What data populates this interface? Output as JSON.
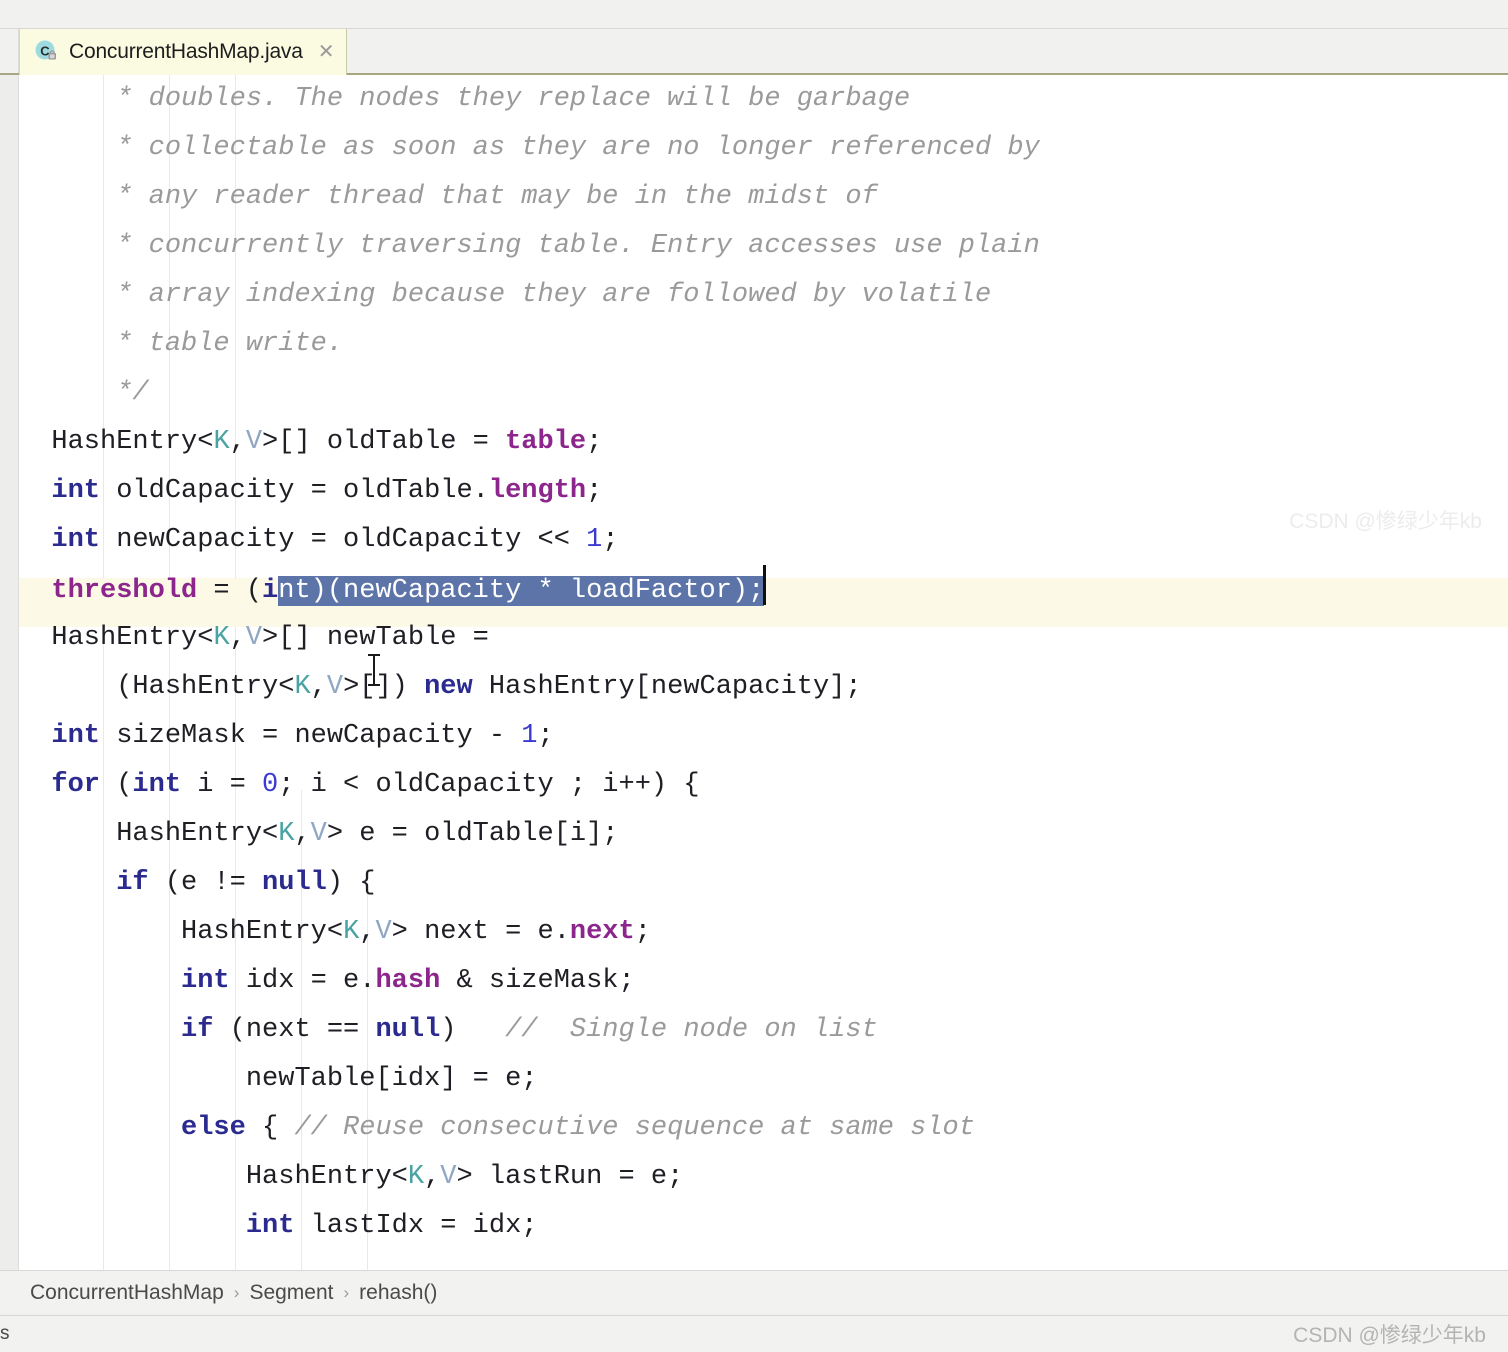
{
  "window": {
    "app": "IntelliJ IDEA Editor"
  },
  "tabs": [
    {
      "label": "ConcurrentHashMap.java",
      "icon": "java-class-locked-icon",
      "close_icon": "close-icon",
      "active": true
    }
  ],
  "breadcrumb": {
    "separator": "›",
    "items": [
      "ConcurrentHashMap",
      "Segment",
      "rehash()"
    ]
  },
  "statusbar": {
    "watermark": "CSDN @惨绿少年kb",
    "left_clipped": "s"
  },
  "editor": {
    "highlighted_line_index": 10,
    "selection": {
      "line_index": 10,
      "text": "nt)(newCapacity * loadFactor);",
      "caret_after": true
    },
    "colors": {
      "background": "#ffffff",
      "current_line": "#fcfae6",
      "selection_bg": "#5d74a8",
      "selection_fg": "#ffffff",
      "comment": "#9a9a9a",
      "keyword": "#2b2b8f",
      "field": "#8c258c",
      "generic_k": "#49a3a3",
      "generic_v": "#8fa6c4",
      "number": "#3a3ad0",
      "plain": "#1e1e24",
      "tab_active_bg": "#fbfbe2",
      "tab_underline": "#a6a680",
      "gutter": "#ededeb"
    },
    "lines": [
      {
        "indent": 1,
        "tokens": [
          {
            "t": "cm",
            "v": "* doubles. The nodes they replace will be garbage"
          }
        ]
      },
      {
        "indent": 1,
        "tokens": [
          {
            "t": "cm",
            "v": "* collectable as soon as they are no longer referenced by"
          }
        ]
      },
      {
        "indent": 1,
        "tokens": [
          {
            "t": "cm",
            "v": "* any reader thread that may be in the midst of"
          }
        ]
      },
      {
        "indent": 1,
        "tokens": [
          {
            "t": "cm",
            "v": "* concurrently traversing table. Entry accesses use plain"
          }
        ]
      },
      {
        "indent": 1,
        "tokens": [
          {
            "t": "cm",
            "v": "* array indexing because they are followed by volatile"
          }
        ]
      },
      {
        "indent": 1,
        "tokens": [
          {
            "t": "cm",
            "v": "* table write."
          }
        ]
      },
      {
        "indent": 1,
        "tokens": [
          {
            "t": "cm",
            "v": "*/"
          }
        ]
      },
      {
        "indent": 0,
        "tokens": [
          {
            "t": "pl",
            "v": "HashEntry"
          },
          {
            "t": "pl",
            "v": "<"
          },
          {
            "t": "gk",
            "v": "K"
          },
          {
            "t": "pl",
            "v": ","
          },
          {
            "t": "gv",
            "v": "V"
          },
          {
            "t": "pl",
            "v": ">[] oldTable = "
          },
          {
            "t": "fld",
            "v": "table"
          },
          {
            "t": "pl",
            "v": ";"
          }
        ]
      },
      {
        "indent": 0,
        "tokens": [
          {
            "t": "kw",
            "v": "int"
          },
          {
            "t": "pl",
            "v": " oldCapacity = oldTable."
          },
          {
            "t": "fld",
            "v": "length"
          },
          {
            "t": "pl",
            "v": ";"
          }
        ]
      },
      {
        "indent": 0,
        "tokens": [
          {
            "t": "kw",
            "v": "int"
          },
          {
            "t": "pl",
            "v": " newCapacity = oldCapacity << "
          },
          {
            "t": "num",
            "v": "1"
          },
          {
            "t": "pl",
            "v": ";"
          }
        ]
      },
      {
        "indent": 0,
        "highlighted": true,
        "tokens": [
          {
            "t": "fld",
            "v": "threshold"
          },
          {
            "t": "pl",
            "v": " = ("
          },
          {
            "t": "kw",
            "v": "i"
          },
          {
            "t": "sel",
            "v": "nt)(newCapacity * loadFactor);"
          },
          {
            "t": "caret",
            "v": ""
          }
        ]
      },
      {
        "indent": 0,
        "tokens": [
          {
            "t": "pl",
            "v": "HashEntry<"
          },
          {
            "t": "gk",
            "v": "K"
          },
          {
            "t": "pl",
            "v": ","
          },
          {
            "t": "gv",
            "v": "V"
          },
          {
            "t": "pl",
            "v": ">[] newTable ="
          }
        ]
      },
      {
        "indent": 1,
        "tokens": [
          {
            "t": "pl",
            "v": "(HashEntry<"
          },
          {
            "t": "gk",
            "v": "K"
          },
          {
            "t": "pl",
            "v": ","
          },
          {
            "t": "gv",
            "v": "V"
          },
          {
            "t": "pl",
            "v": ">[]) "
          },
          {
            "t": "kw",
            "v": "new"
          },
          {
            "t": "pl",
            "v": " HashEntry[newCapacity];"
          }
        ]
      },
      {
        "indent": 0,
        "tokens": [
          {
            "t": "kw",
            "v": "int"
          },
          {
            "t": "pl",
            "v": " sizeMask = newCapacity - "
          },
          {
            "t": "num",
            "v": "1"
          },
          {
            "t": "pl",
            "v": ";"
          }
        ]
      },
      {
        "indent": 0,
        "tokens": [
          {
            "t": "kw",
            "v": "for"
          },
          {
            "t": "pl",
            "v": " ("
          },
          {
            "t": "kw",
            "v": "int"
          },
          {
            "t": "pl",
            "v": " i = "
          },
          {
            "t": "num",
            "v": "0"
          },
          {
            "t": "pl",
            "v": "; i < oldCapacity ; i++) {"
          }
        ]
      },
      {
        "indent": 1,
        "tokens": [
          {
            "t": "pl",
            "v": "HashEntry<"
          },
          {
            "t": "gk",
            "v": "K"
          },
          {
            "t": "pl",
            "v": ","
          },
          {
            "t": "gv",
            "v": "V"
          },
          {
            "t": "pl",
            "v": "> e = oldTable[i];"
          }
        ]
      },
      {
        "indent": 1,
        "tokens": [
          {
            "t": "kw",
            "v": "if"
          },
          {
            "t": "pl",
            "v": " (e != "
          },
          {
            "t": "kw",
            "v": "null"
          },
          {
            "t": "pl",
            "v": ") {"
          }
        ]
      },
      {
        "indent": 2,
        "tokens": [
          {
            "t": "pl",
            "v": "HashEntry<"
          },
          {
            "t": "gk",
            "v": "K"
          },
          {
            "t": "pl",
            "v": ","
          },
          {
            "t": "gv",
            "v": "V"
          },
          {
            "t": "pl",
            "v": "> next = e."
          },
          {
            "t": "fld",
            "v": "next"
          },
          {
            "t": "pl",
            "v": ";"
          }
        ]
      },
      {
        "indent": 2,
        "tokens": [
          {
            "t": "kw",
            "v": "int"
          },
          {
            "t": "pl",
            "v": " idx = e."
          },
          {
            "t": "fld",
            "v": "hash"
          },
          {
            "t": "pl",
            "v": " & sizeMask;"
          }
        ]
      },
      {
        "indent": 2,
        "tokens": [
          {
            "t": "kw",
            "v": "if"
          },
          {
            "t": "pl",
            "v": " (next == "
          },
          {
            "t": "kw",
            "v": "null"
          },
          {
            "t": "pl",
            "v": ")   "
          },
          {
            "t": "cm",
            "v": "//  Single node on list"
          }
        ]
      },
      {
        "indent": 3,
        "tokens": [
          {
            "t": "pl",
            "v": "newTable[idx] = e;"
          }
        ]
      },
      {
        "indent": 2,
        "tokens": [
          {
            "t": "kw",
            "v": "else"
          },
          {
            "t": "pl",
            "v": " { "
          },
          {
            "t": "cm",
            "v": "// Reuse consecutive sequence at same slot"
          }
        ]
      },
      {
        "indent": 3,
        "tokens": [
          {
            "t": "pl",
            "v": "HashEntry<"
          },
          {
            "t": "gk",
            "v": "K"
          },
          {
            "t": "pl",
            "v": ","
          },
          {
            "t": "gv",
            "v": "V"
          },
          {
            "t": "pl",
            "v": "> lastRun = e;"
          }
        ]
      },
      {
        "indent": 3,
        "tokens": [
          {
            "t": "kw",
            "v": "int"
          },
          {
            "t": "pl",
            "v": " lastIdx = idx;"
          }
        ]
      }
    ]
  }
}
